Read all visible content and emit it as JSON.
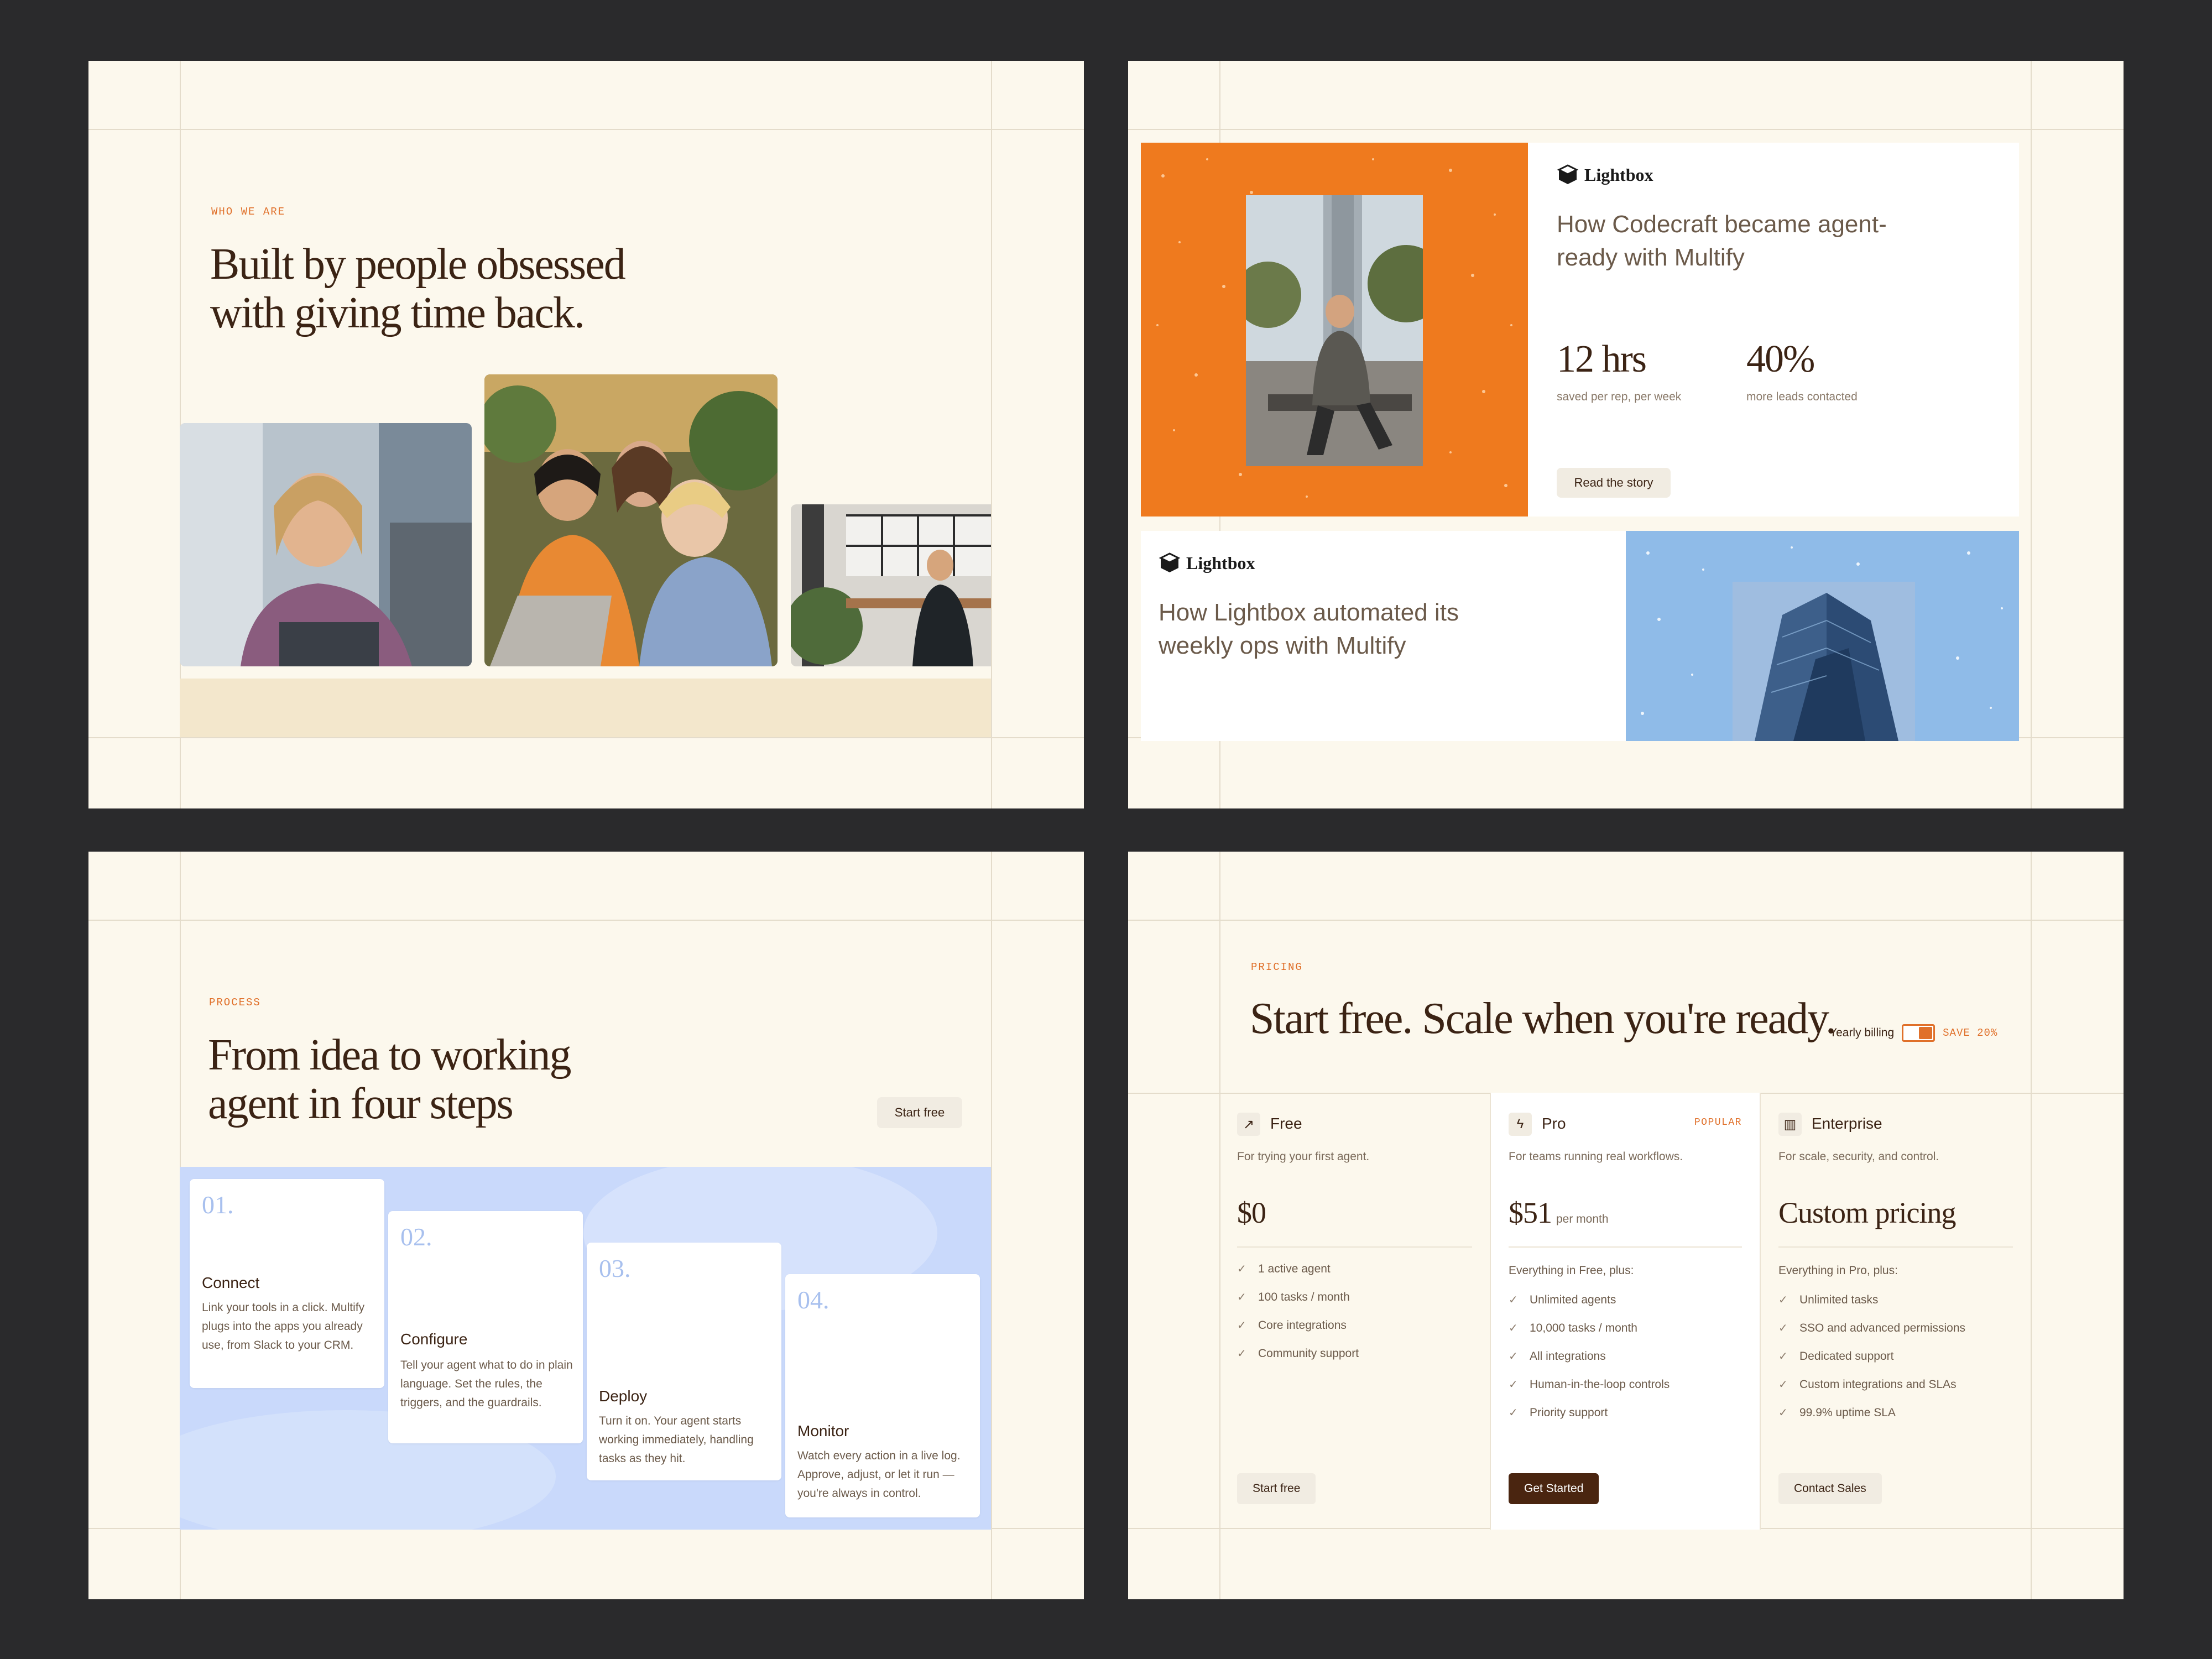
{
  "about": {
    "eyebrow": "WHO WE ARE",
    "heading_line1": "Built by people obsessed",
    "heading_line2": "with giving time back."
  },
  "case_studies": [
    {
      "brand": "Lightbox",
      "title": "How Codecraft became agent-ready with Multify",
      "stats": [
        {
          "value": "12 hrs",
          "label": "saved per rep, per week"
        },
        {
          "value": "40%",
          "label": "more leads contacted"
        }
      ],
      "cta": "Read the story"
    },
    {
      "brand": "Lightbox",
      "title": "How Lightbox automated its weekly ops with Multify"
    }
  ],
  "process": {
    "eyebrow": "PROCESS",
    "heading_line1": "From idea to working",
    "heading_line2": "agent in four steps",
    "cta": "Start free",
    "steps": [
      {
        "num": "01.",
        "title": "Connect",
        "desc": "Link your tools in a click. Multify plugs into the apps you already use, from Slack to your CRM."
      },
      {
        "num": "02.",
        "title": "Configure",
        "desc": "Tell your agent what to do in plain language. Set the rules, the triggers, and the guardrails."
      },
      {
        "num": "03.",
        "title": "Deploy",
        "desc": "Turn it on. Your agent starts working immediately, handling tasks as they hit."
      },
      {
        "num": "04.",
        "title": "Monitor",
        "desc": "Watch every action in a live log. Approve, adjust, or let it run — you're always in control."
      }
    ]
  },
  "pricing": {
    "eyebrow": "PRICING",
    "heading": "Start free. Scale when you're ready.",
    "billing_label": "Yearly billing",
    "billing_yearly_on": true,
    "save_label": "SAVE 20%",
    "plans": [
      {
        "icon": "arrow-up-right-icon",
        "glyph": "↗",
        "name": "Free",
        "desc": "For trying your first agent.",
        "price": "$0",
        "per": "",
        "intro": "",
        "features": [
          "1 active agent",
          "100 tasks / month",
          "Core integrations",
          "Community support"
        ],
        "cta": "Start free"
      },
      {
        "icon": "lightning-icon",
        "glyph": "ϟ",
        "name": "Pro",
        "badge": "POPULAR",
        "desc": "For teams running real workflows.",
        "price": "$51",
        "per": "per month",
        "intro": "Everything in Free, plus:",
        "features": [
          "Unlimited agents",
          "10,000 tasks / month",
          "All integrations",
          "Human-in-the-loop controls",
          "Priority support"
        ],
        "cta": "Get Started"
      },
      {
        "icon": "bar-chart-icon",
        "glyph": "▥",
        "name": "Enterprise",
        "desc": "For scale, security, and control.",
        "price": "Custom pricing",
        "per": "",
        "intro": "Everything in Pro, plus:",
        "features": [
          "Unlimited tasks",
          "SSO and advanced permissions",
          "Dedicated support",
          "Custom integrations and SLAs",
          "99.9% uptime SLA"
        ],
        "cta": "Contact Sales"
      }
    ]
  }
}
